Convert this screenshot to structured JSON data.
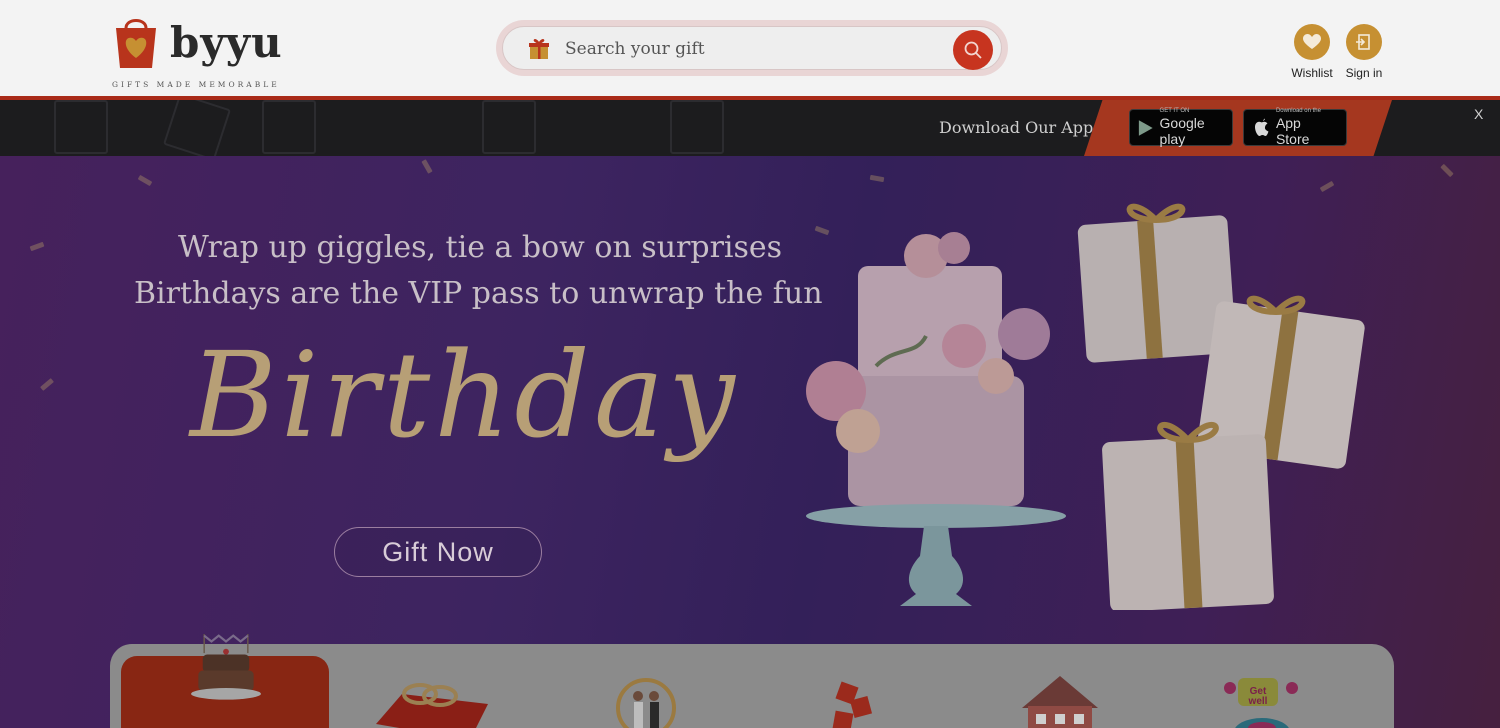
{
  "header": {
    "logo_text": "byyu",
    "logo_tagline": "GIFTS MADE MEMORABLE",
    "search_placeholder": "Search your gift",
    "wishlist_label": "Wishlist",
    "signin_label": "Sign in"
  },
  "app_banner": {
    "text": "Download Our App",
    "google_play": {
      "small": "GET IT ON",
      "big": "Google play"
    },
    "app_store": {
      "small": "Download on the",
      "big": "App Store"
    },
    "close_label": "X"
  },
  "hero": {
    "line1": "Wrap up giggles, tie a bow on surprises",
    "line2": "Birthdays are the VIP pass to unwrap the fun",
    "title": "Birthday",
    "cta": "Gift Now"
  },
  "categories": [
    {
      "icon": "birthday-cake-icon"
    },
    {
      "icon": "wedding-rings-icon"
    },
    {
      "icon": "couple-icon"
    },
    {
      "icon": "gift-bouquet-icon"
    },
    {
      "icon": "house-icon"
    },
    {
      "icon": "get-well-icon"
    }
  ],
  "colors": {
    "accent": "#c7341f",
    "gold": "#c69032",
    "hero_bg": "#3d2460"
  }
}
